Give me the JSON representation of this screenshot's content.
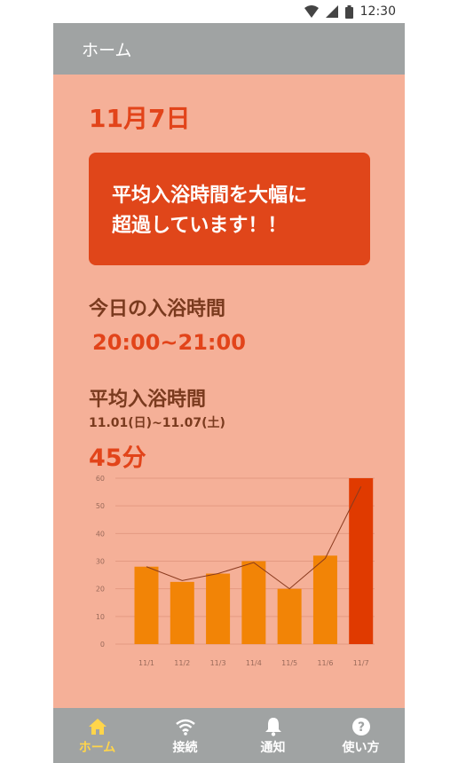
{
  "status_bar": {
    "time": "12:30"
  },
  "app_bar": {
    "title": "ホーム"
  },
  "date": "11月7日",
  "alert": {
    "line1": "平均入浴時間を大幅に",
    "line2": "超過しています！！"
  },
  "today": {
    "title": "今日の入浴時間",
    "time_range": "20:00~21:00"
  },
  "average": {
    "title": "平均入浴時間",
    "period": "11.01(日)~11.07(土)",
    "value": "45分"
  },
  "chart_data": {
    "type": "bar",
    "categories": [
      "11/1",
      "11/2",
      "11/3",
      "11/4",
      "11/5",
      "11/6",
      "11/7"
    ],
    "values": [
      28,
      22.5,
      25.5,
      30,
      20,
      32,
      60
    ],
    "line_values": [
      28,
      23,
      25.5,
      29.5,
      20,
      31,
      57
    ],
    "ylim": [
      0,
      60
    ],
    "yticks": [
      0,
      10,
      20,
      30,
      40,
      50,
      60
    ],
    "bar_color": "#f28406",
    "highlight_color": "#e03a00",
    "highlight_index": 6,
    "line_color": "#8a3a1e",
    "grid": true
  },
  "bottom_nav": [
    {
      "label": "ホーム",
      "icon": "home-icon",
      "active": true
    },
    {
      "label": "接続",
      "icon": "wifi-icon",
      "active": false
    },
    {
      "label": "通知",
      "icon": "bell-icon",
      "active": false
    },
    {
      "label": "使い方",
      "icon": "help-icon",
      "active": false
    }
  ],
  "colors": {
    "background": "#f5b098",
    "accent": "#e2441a",
    "bar": "#a0a3a3",
    "active_nav": "#ffd54a"
  }
}
